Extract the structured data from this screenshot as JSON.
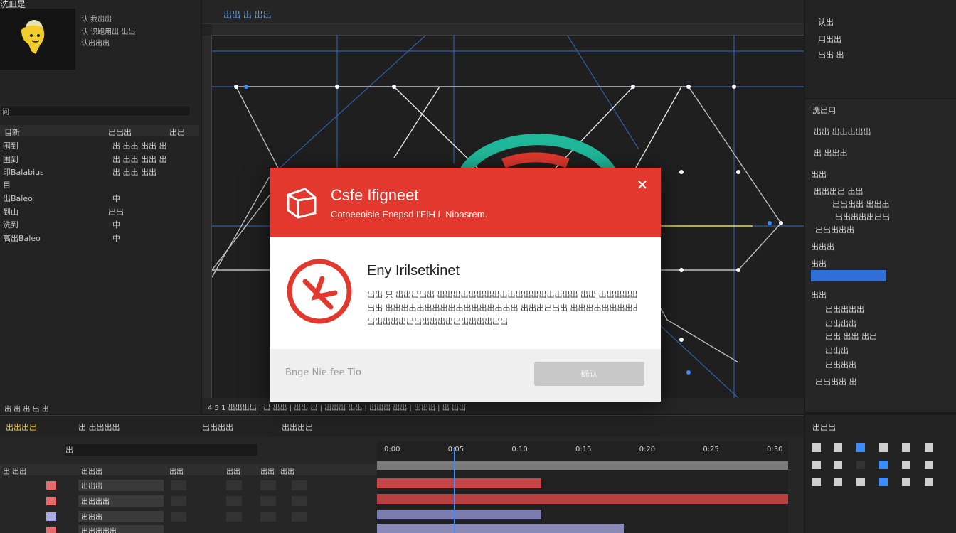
{
  "project": {
    "title": "洗皿是",
    "meta": [
      "认 我出出",
      "认 识跑用出 出出",
      "认出出出"
    ],
    "search_placeholder": "问",
    "columns": [
      "目新",
      "出出出",
      "出出"
    ],
    "items": [
      {
        "name": "围到",
        "info": "出 出出  出出 出"
      },
      {
        "name": "围到",
        "info": "出 出出  出出 出"
      },
      {
        "name": "印Balabius",
        "info": "出 出出  出出"
      },
      {
        "name": "目",
        "info": ""
      },
      {
        "name": "出Baleo",
        "info": "中"
      },
      {
        "name": "到山",
        "info": "出出"
      },
      {
        "name": "洗到",
        "info": "中"
      },
      {
        "name": "高出Baleo",
        "info": "中"
      }
    ],
    "footer": "出 出 出 出 出"
  },
  "viewer": {
    "tabs": [
      "出出 出 出出"
    ],
    "footer": "4 5 1 出出出出 | 出 出出 | 出出 出 | 出出出 出出 | 出出出 出出 | 出出出 | 出 出出"
  },
  "right_top": {
    "rows": [
      "认出",
      "用出出",
      "出出 出"
    ]
  },
  "effects": {
    "header": "洗出用",
    "rows": [
      {
        "label": "出出 出出出出出",
        "top": true
      },
      {
        "label": "出 出出出",
        "top": false
      },
      {
        "label": "出出",
        "top": false
      },
      {
        "label": "出出出出   出出",
        "top": false
      },
      {
        "label": "出出出出   出出出",
        "top": false
      },
      {
        "label": "出出出出出出出",
        "top": false
      },
      {
        "label": "出出出出出",
        "top": false
      },
      {
        "label": "出出出",
        "top": false
      },
      {
        "label": "出出",
        "top": false
      },
      {
        "label": "出出",
        "top": false
      },
      {
        "label": "出出出出出",
        "top": false
      },
      {
        "label": "出出出出",
        "top": false
      },
      {
        "label": "出出 出出  出出",
        "top": false
      },
      {
        "label": "出出出",
        "top": false
      },
      {
        "label": "出出出出",
        "top": false
      },
      {
        "label": "出出出出  出",
        "top": false
      }
    ]
  },
  "right_bottom": {
    "header": "出出出"
  },
  "timeline": {
    "tabs": [
      "出出出出",
      "出 出出出出",
      "出出出出",
      "出出出出"
    ],
    "search_placeholder": "出",
    "columns": [
      "出 出出",
      "出出出",
      "出出",
      "出出",
      "出出",
      "出出"
    ],
    "layers": [
      {
        "name": "出出出",
        "color": "#e86b6b",
        "bar_color": "#c44545",
        "bar_start": 0.0,
        "bar_end": 0.4
      },
      {
        "name": "出出出出",
        "color": "#e86b6b",
        "bar_color": "#b84040",
        "bar_start": 0.0,
        "bar_end": 1.0
      },
      {
        "name": "出出出",
        "color": "#a9a9e8",
        "bar_color": "#7b7bb0",
        "bar_start": 0.0,
        "bar_end": 0.4
      },
      {
        "name": "出出出出出",
        "color": "#e86b6b",
        "bar_color": "#8a8ab8",
        "bar_start": 0.0,
        "bar_end": 0.6
      }
    ],
    "ruler": [
      "0:00",
      "0:05",
      "0:10",
      "0:15",
      "0:20",
      "0:25",
      "0:30"
    ]
  },
  "dialog": {
    "title": "Csfe Ifigneet",
    "subtitle": "Cotneeoisie Enepsd I'FIH L Nioasrem.",
    "body_title": "Eny Irilsetkinet",
    "body_lines": [
      "出出 只 出出出出出 出出出出出出出出出出出出出出出出出出 出出 出出出出出出出",
      "出出 出出出出出出出出出出出出出出出出出 出出出出出出 出出出出出出出出出出出出",
      "出出出出出出出出出出出出出出出出出出"
    ],
    "footer_text": "Bnge Nie fee Tio",
    "button_label": "确认",
    "colors": {
      "header": "#e2382d",
      "icon": "#e2382d"
    }
  },
  "colors": {
    "accent": "#3a8cff",
    "panel": "#232323"
  }
}
